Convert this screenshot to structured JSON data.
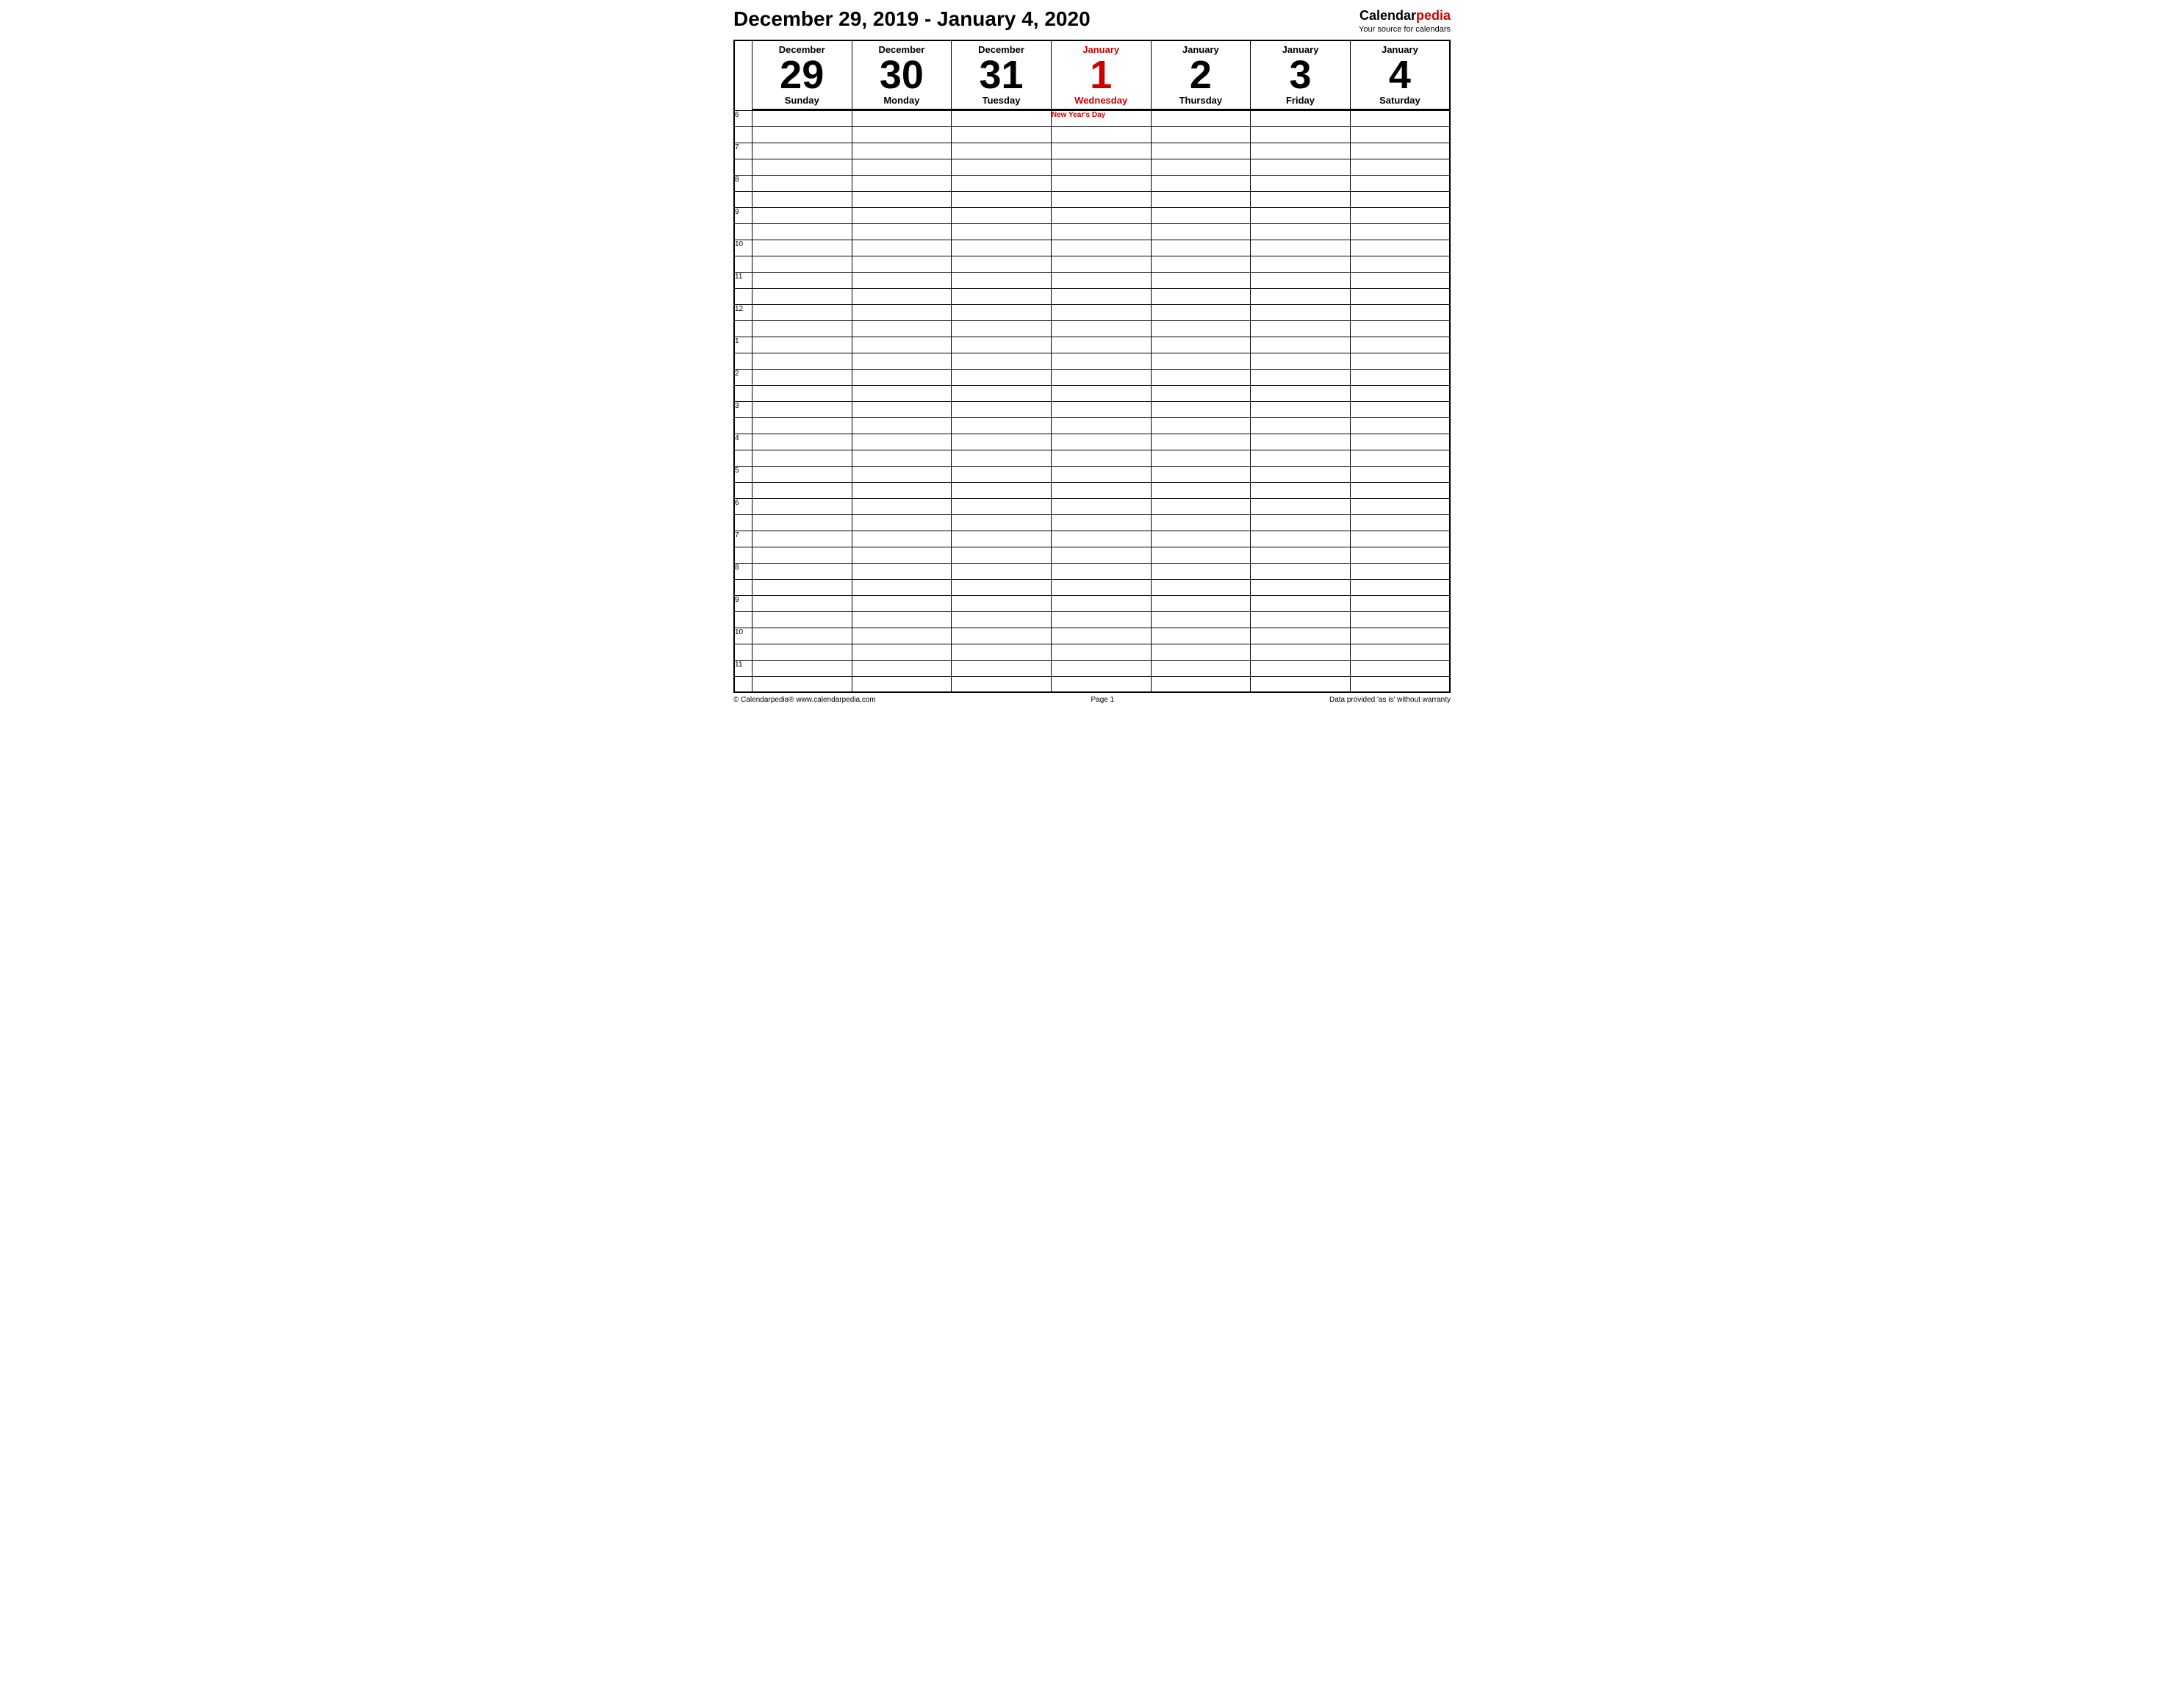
{
  "header": {
    "title": "December 29, 2019 - January 4, 2020",
    "brand_name_part1": "Calendar",
    "brand_name_part2": "pedia",
    "brand_sub": "Your source for calendars"
  },
  "days": [
    {
      "month": "December",
      "month_red": false,
      "num": "29",
      "num_red": false,
      "name": "Sunday",
      "name_red": false
    },
    {
      "month": "December",
      "month_red": false,
      "num": "30",
      "num_red": false,
      "name": "Monday",
      "name_red": false
    },
    {
      "month": "December",
      "month_red": false,
      "num": "31",
      "num_red": false,
      "name": "Tuesday",
      "name_red": false
    },
    {
      "month": "January",
      "month_red": true,
      "num": "1",
      "num_red": true,
      "name": "Wednesday",
      "name_red": true
    },
    {
      "month": "January",
      "month_red": false,
      "num": "2",
      "num_red": false,
      "name": "Thursday",
      "name_red": false
    },
    {
      "month": "January",
      "month_red": false,
      "num": "3",
      "num_red": false,
      "name": "Friday",
      "name_red": false
    },
    {
      "month": "January",
      "month_red": false,
      "num": "4",
      "num_red": false,
      "name": "Saturday",
      "name_red": false
    }
  ],
  "time_slots": [
    "6",
    "",
    "7",
    "",
    "8",
    "",
    "9",
    "",
    "10",
    "",
    "11",
    "",
    "12",
    "",
    "1",
    "",
    "2",
    "",
    "3",
    "",
    "4",
    "",
    "5",
    "",
    "6",
    "",
    "7",
    "",
    "8",
    "",
    "9",
    "",
    "10",
    "",
    "11",
    ""
  ],
  "time_labels": [
    "6",
    "7",
    "8",
    "9",
    "10",
    "11",
    "12",
    "1",
    "2",
    "3",
    "4",
    "5",
    "6",
    "7",
    "8",
    "9",
    "10",
    "11"
  ],
  "holiday": {
    "day_index": 3,
    "slot_index": 0,
    "text": "New Year's Day"
  },
  "footer": {
    "left": "© Calendarpedia®   www.calendarpedia.com",
    "center": "Page 1",
    "right": "Data provided 'as is' without warranty"
  }
}
